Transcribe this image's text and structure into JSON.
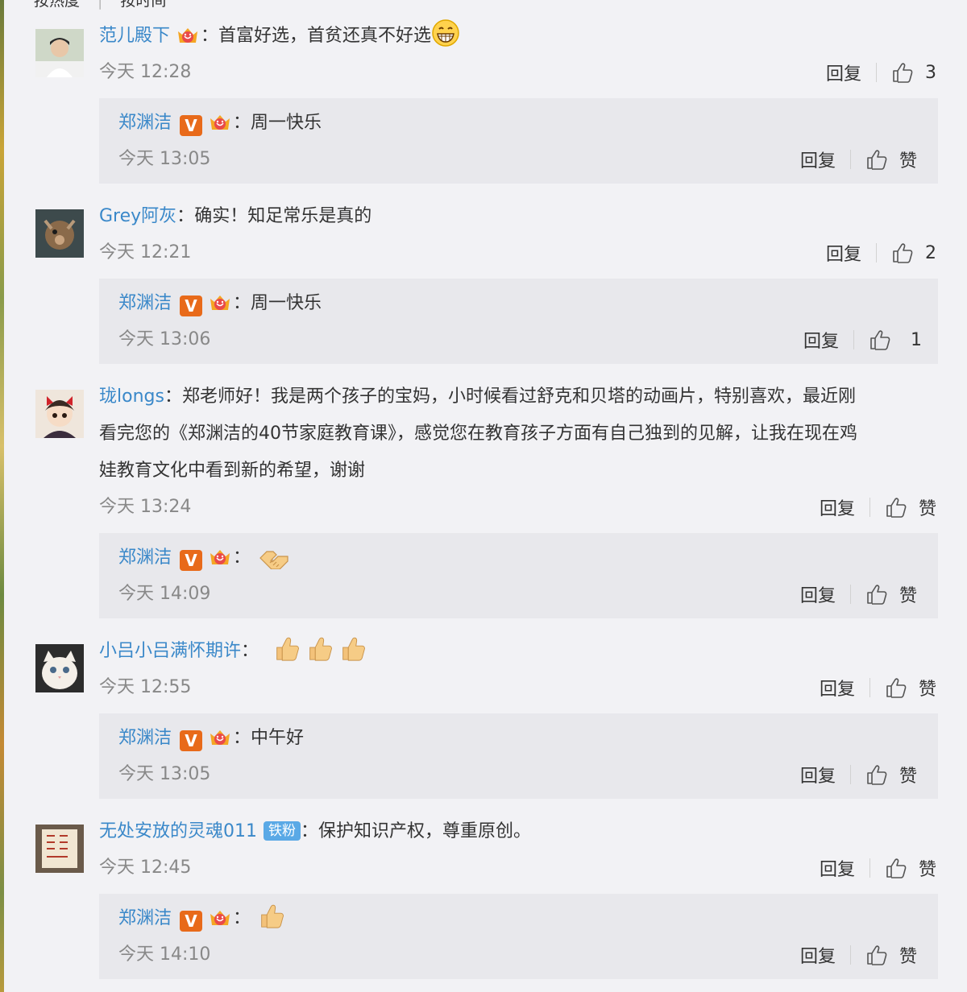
{
  "top_tabs": [
    "按热度",
    "按时间"
  ],
  "colors": {
    "username": "#3a88c9",
    "time": "#888888",
    "vbadge": "#e86a1a",
    "fan_badge": "#5aa9e6",
    "reply_bg": "#e8e8ec"
  },
  "labels": {
    "reply": "回复",
    "like": "赞"
  },
  "comments": [
    {
      "user": "范儿殿下",
      "text": "首富好选，首贫还真不好选",
      "emoji": "grin-emoji",
      "time": "今天 12:28",
      "likes": "3",
      "reply": {
        "user": "郑渊洁",
        "text": "周一快乐",
        "time": "今天 13:05",
        "likes": "赞"
      }
    },
    {
      "user": "Grey阿灰",
      "text": "确实！知足常乐是真的",
      "time": "今天 12:21",
      "likes": "2",
      "reply": {
        "user": "郑渊洁",
        "text": "周一快乐",
        "time": "今天 13:06",
        "likes": "1"
      }
    },
    {
      "user": "珑longs",
      "text_lines": [
        "郑老师好！我是两个孩子的宝妈，小时候看过舒克和贝塔的动画片，特别喜欢，最近刚",
        "看完您的《郑渊洁的40节家庭教育课》，感觉您在教育孩子方面有自己独到的见解，让我在现在鸡",
        "娃教育文化中看到新的希望，谢谢"
      ],
      "time": "今天 13:24",
      "likes": "赞",
      "reply": {
        "user": "郑渊洁",
        "text": "",
        "emoji": "handshake-emoji",
        "time": "今天 14:09",
        "likes": "赞"
      }
    },
    {
      "user": "小吕小吕满怀期许",
      "text": "",
      "emoji": "thumbs-up-emoji x3",
      "time": "今天 12:55",
      "likes": "赞",
      "reply": {
        "user": "郑渊洁",
        "text": "中午好",
        "time": "今天 13:05",
        "likes": "赞"
      }
    },
    {
      "user": "无处安放的灵魂011",
      "badge": "铁粉",
      "text": "保护知识产权，尊重原创。",
      "time": "今天 12:45",
      "likes": "赞",
      "reply": {
        "user": "郑渊洁",
        "text": "",
        "emoji": "thumbs-up-emoji",
        "time": "今天 14:10",
        "likes": "赞"
      }
    }
  ]
}
